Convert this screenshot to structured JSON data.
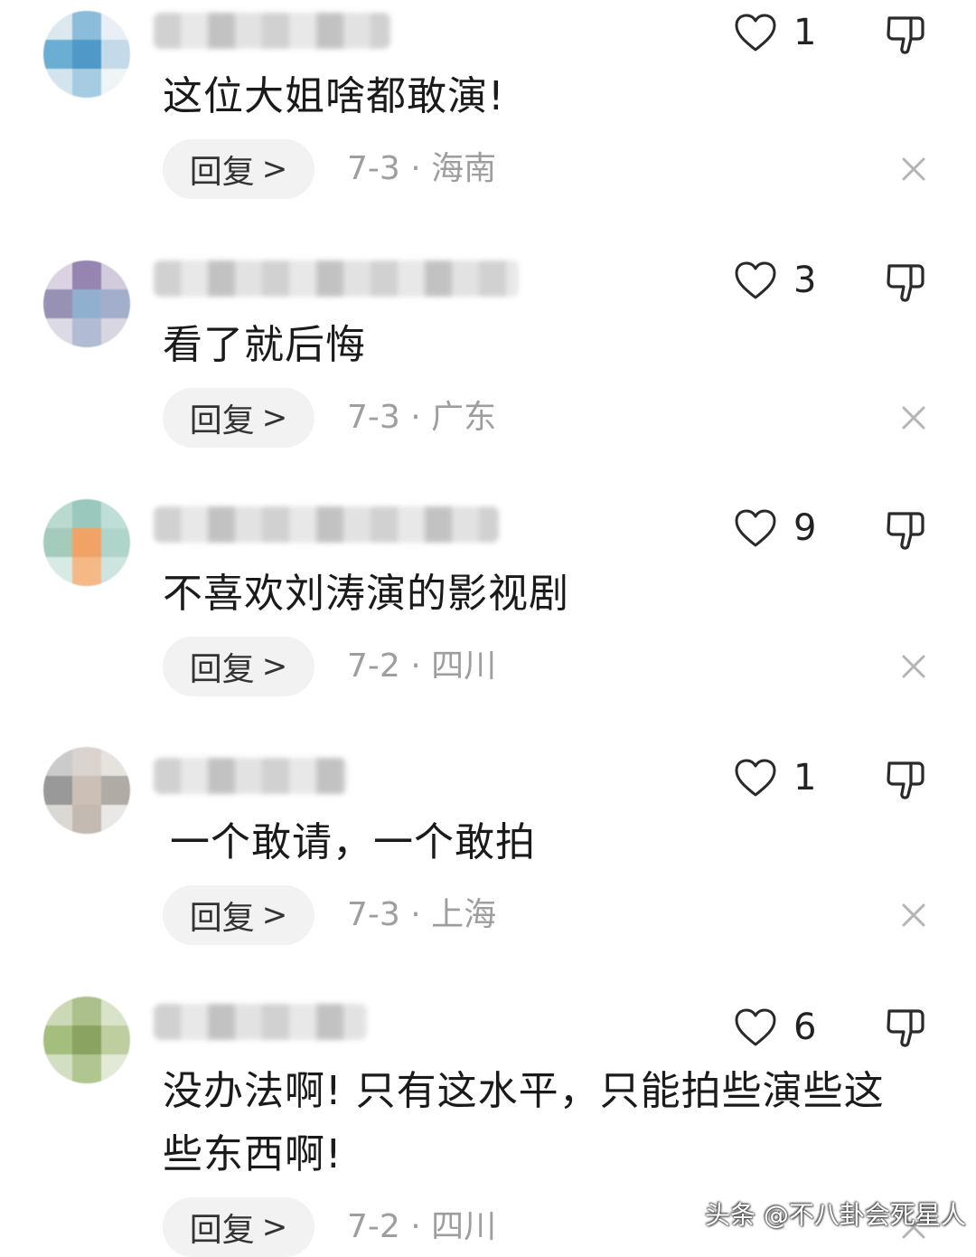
{
  "comments": [
    {
      "text": "这位大姐啥都敢演!",
      "likes": "1",
      "reply_label": "回复",
      "date": "7-3",
      "separator": "·",
      "location": "海南",
      "avatar_colors": [
        "#d8e6ee",
        "#7fb6d8",
        "#e7eef3",
        "#5aa6cf",
        "#3d8fc4",
        "#bcd7e8",
        "#cfe2ee",
        "#9cc7e1",
        "#eef3f6"
      ]
    },
    {
      "text": "看了就后悔",
      "likes": "3",
      "reply_label": "回复",
      "date": "7-3",
      "separator": "·",
      "location": "广东",
      "avatar_colors": [
        "#d8cfe0",
        "#8a78a8",
        "#cdc6d8",
        "#8c86ac",
        "#86a8cc",
        "#9aa6c8",
        "#d9d6e2",
        "#aab4d0",
        "#d3d2de"
      ]
    },
    {
      "text": "不喜欢刘涛演的影视剧",
      "likes": "9",
      "reply_label": "回复",
      "date": "7-2",
      "separator": "·",
      "location": "四川",
      "avatar_colors": [
        "#b3d6cc",
        "#8fc3b6",
        "#b9dbd3",
        "#9bc6b4",
        "#f09a55",
        "#a7d1c6",
        "#d4e8e2",
        "#f5b27b",
        "#c8e2dc"
      ]
    },
    {
      "text": "一个敢请，一个敢拍",
      "likes": "1",
      "reply_label": "回复",
      "date": "7-3",
      "separator": "·",
      "location": "上海",
      "avatar_colors": [
        "#c6c6c6",
        "#d6cfc9",
        "#e4e0dc",
        "#8f8f8f",
        "#c7b9ad",
        "#a9a29c",
        "#d8d4d0",
        "#bdb3aa",
        "#e8e6e4"
      ]
    },
    {
      "text": "没办法啊! 只有这水平，只能拍些演些这些东西啊!",
      "likes": "6",
      "reply_label": "回复",
      "date": "7-2",
      "separator": "·",
      "location": "四川",
      "avatar_colors": [
        "#c7d5b0",
        "#a4ba80",
        "#d5e0c4",
        "#9ab76f",
        "#7f9a4f",
        "#b7c995",
        "#cfdcbd",
        "#a8bf84",
        "#dfe7d2"
      ]
    }
  ],
  "watermark": "头条 @不八卦会死星人"
}
